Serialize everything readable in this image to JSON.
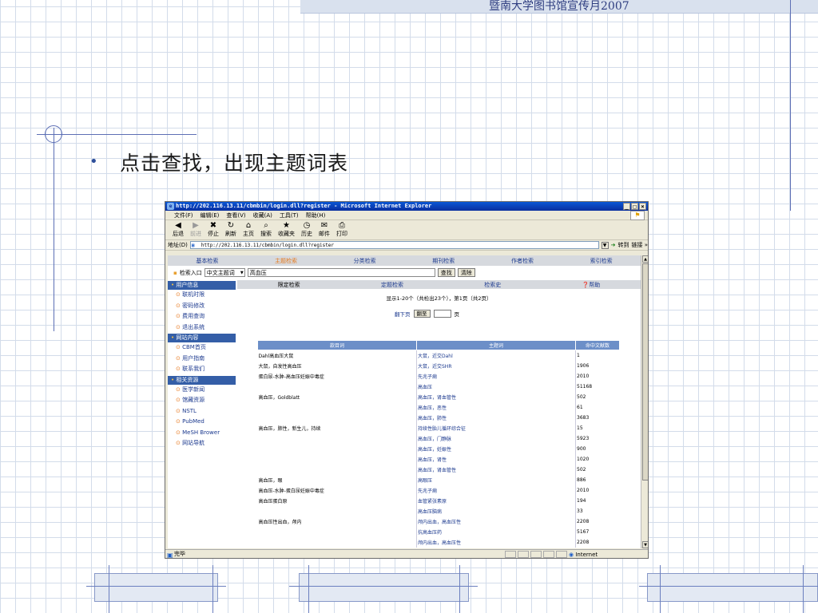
{
  "slide": {
    "header_text": "暨南大学图书馆宣传月2007",
    "bullet": "•",
    "bullet_text": "点击查找，出现主题词表"
  },
  "browser": {
    "window_title": "http://202.116.13.11/cbmbin/login.dll?register - Microsoft Internet Explorer",
    "window_buttons": [
      "_",
      "□",
      "×"
    ],
    "menu": [
      "文件(F)",
      "编辑(E)",
      "查看(V)",
      "收藏(A)",
      "工具(T)",
      "帮助(H)"
    ],
    "toolbar": [
      {
        "label": "后退",
        "icon": "back-icon",
        "glyph": "◀"
      },
      {
        "label": "前进",
        "icon": "forward-icon",
        "glyph": "▶"
      },
      {
        "label": "停止",
        "icon": "stop-icon",
        "glyph": "✖"
      },
      {
        "label": "刷新",
        "icon": "refresh-icon",
        "glyph": "↻"
      },
      {
        "label": "主页",
        "icon": "home-icon",
        "glyph": "⌂"
      },
      {
        "label": "搜索",
        "icon": "search-icon",
        "glyph": "⌕"
      },
      {
        "label": "收藏夹",
        "icon": "favorites-icon",
        "glyph": "★"
      },
      {
        "label": "历史",
        "icon": "history-icon",
        "glyph": "◷"
      },
      {
        "label": "邮件",
        "icon": "mail-icon",
        "glyph": "✉"
      },
      {
        "label": "打印",
        "icon": "print-icon",
        "glyph": "⎙"
      }
    ],
    "address_label": "地址(D)",
    "address_value": "http://202.116.13.11/cbmbin/login.dll?register",
    "go_label": "转到",
    "links_label": "链接 »",
    "status_text": "完毕",
    "zone_text": "Internet"
  },
  "page": {
    "tabs": [
      "基本检索",
      "主题检索",
      "分类检索",
      "期刊检索",
      "作者检索",
      "索引检索"
    ],
    "active_tab": "主题检索",
    "search_entry_label": "检索入口",
    "search_field": "中文主题词",
    "search_query": "高血压",
    "find_button": "查找",
    "clear_button": "清除",
    "sidebar": [
      {
        "title": "用户信息",
        "items": [
          "联机时限",
          "密码修改",
          "费用查询",
          "退出系统"
        ]
      },
      {
        "title": "网站内容",
        "items": [
          "CBM首页",
          "用户指南",
          "联系我们"
        ]
      },
      {
        "title": "相关资源",
        "items": [
          "医学新闻",
          "馆藏资源",
          "NSTL",
          "PubMed",
          "MeSH Brower",
          "网站导航"
        ]
      }
    ],
    "main_header": [
      "限定检索",
      "定题检索",
      "检索史",
      "帮助"
    ],
    "result_text": "显示1-20个（共检出23个），第1页（共2页）",
    "pager": {
      "next": "翻下页",
      "jump": "翻至",
      "page_suffix": "页"
    },
    "table": {
      "headers": [
        "款目词",
        "主题词",
        "命中文献数"
      ],
      "rows": [
        [
          "Dahl高血压大鼠",
          "大鼠，近交Dahl",
          "1"
        ],
        [
          "大鼠，自发性高血压",
          "大鼠，近交SHR",
          "1906"
        ],
        [
          "蛋白尿-水肿-高血压妊娠中毒症",
          "先兆子痫",
          "2010"
        ],
        [
          "",
          "高血压",
          "51168"
        ],
        [
          "高血压，Goldblatt",
          "高血压，肾血管性",
          "502"
        ],
        [
          "",
          "高血压，恶性",
          "61"
        ],
        [
          "",
          "高血压，肺性",
          "3683"
        ],
        [
          "高血压，肺性，新生儿，持续",
          "持续性胎儿循环综合征",
          "15"
        ],
        [
          "",
          "高血压，门静脉",
          "5923"
        ],
        [
          "",
          "高血压，妊娠性",
          "900"
        ],
        [
          "",
          "高血压，肾性",
          "1020"
        ],
        [
          "",
          "高血压，肾血管性",
          "502"
        ],
        [
          "高血压，眼",
          "高眼压",
          "886"
        ],
        [
          "高血压-水肿-蛋白尿妊娠中毒症",
          "先兆子痫",
          "2010"
        ],
        [
          "高血压蛋白原",
          "血管紧张素原",
          "194"
        ],
        [
          "",
          "高血压脑病",
          "33"
        ],
        [
          "高血压性出血，颅内",
          "颅内出血，高血压性",
          "2208"
        ],
        [
          "",
          "抗高血压药",
          "5167"
        ],
        [
          "",
          "颅内出血，高血压性",
          "2208"
        ]
      ]
    }
  }
}
